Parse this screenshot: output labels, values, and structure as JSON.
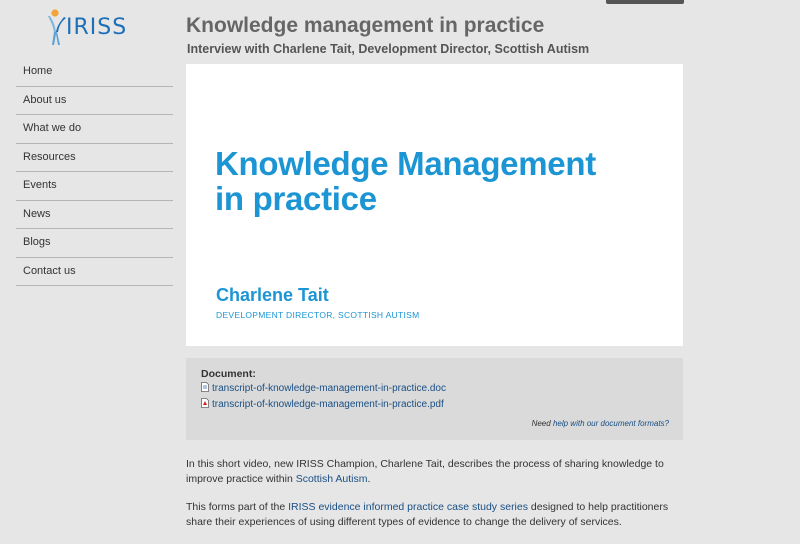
{
  "logo": {
    "text": "IRISS"
  },
  "nav": {
    "items": [
      "Home",
      "About us",
      "What we do",
      "Resources",
      "Events",
      "News",
      "Blogs",
      "Contact us"
    ]
  },
  "page": {
    "title": "Knowledge management in practice",
    "subtitle": "Interview with Charlene Tait, Development Director, Scottish Autism"
  },
  "video": {
    "title_line1": "Knowledge Management",
    "title_line2": "in practice",
    "name": "Charlene Tait",
    "role": "DEVELOPMENT DIRECTOR, SCOTTISH AUTISM"
  },
  "document": {
    "label": "Document:",
    "files": [
      {
        "name": "transcript-of-knowledge-management-in-practice.doc",
        "icon": "doc-file-icon"
      },
      {
        "name": "transcript-of-knowledge-management-in-practice.pdf",
        "icon": "pdf-file-icon"
      }
    ],
    "help_prefix": "Need",
    "help_link": "help with our document formats?"
  },
  "body": {
    "p1_before": "In this short video, new IRISS Champion, Charlene Tait, describes the process of sharing knowledge to improve practice within",
    "p1_link": "Scottish Autism",
    "p1_after": ".",
    "p2_before": "This forms part of the",
    "p2_link": "IRISS evidence informed practice case study series",
    "p2_after": "designed to help practitioners share their experiences of using different types of evidence to change the delivery of services."
  },
  "colors": {
    "accent": "#1c95d4",
    "link": "#1a4f86",
    "background": "#e5e6e5"
  }
}
